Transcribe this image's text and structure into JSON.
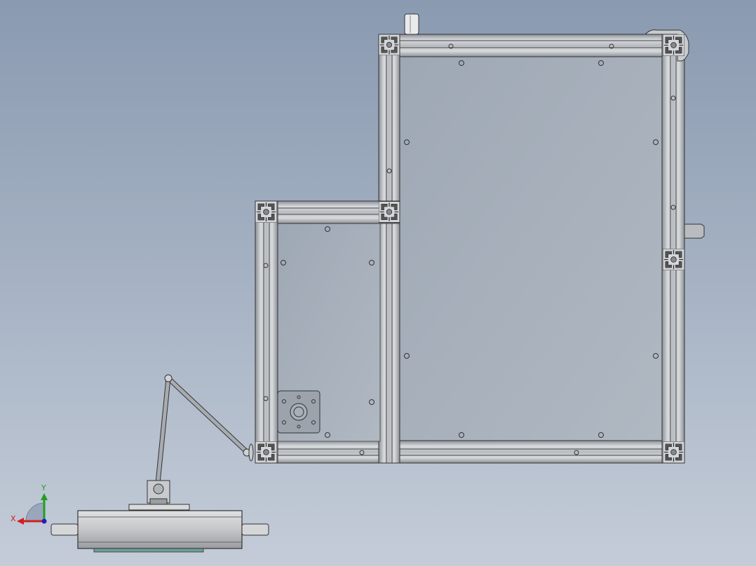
{
  "view": {
    "background_top": "#8a9ab0",
    "background_bottom": "#c4ccd8",
    "frame_color": "#c4c8cc",
    "frame_edge": "#3a3a3a",
    "panel_color": "#a4adb9",
    "stand_color": "#c8c8c8",
    "base_plate_color": "#6aa09a"
  },
  "triad": {
    "x_label": "X",
    "y_label": "Y",
    "x_color": "#d02020",
    "y_color": "#20a020",
    "z_color": "#2020c0"
  }
}
